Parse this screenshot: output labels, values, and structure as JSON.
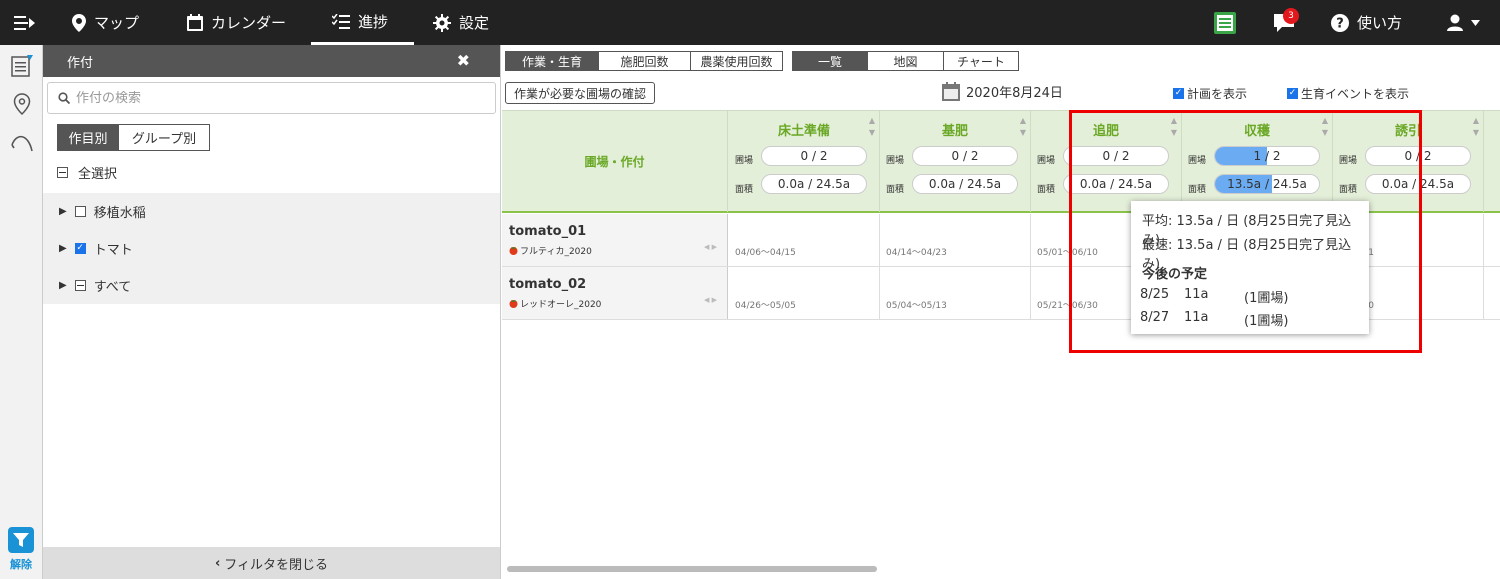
{
  "nav": {
    "items": [
      {
        "label": "マップ"
      },
      {
        "label": "カレンダー"
      },
      {
        "label": "進捗"
      },
      {
        "label": "設定"
      }
    ],
    "notification_count": "3",
    "help_label": "使い方"
  },
  "rail": {
    "release_label": "解除"
  },
  "panel": {
    "title": "作付",
    "search_placeholder": "作付の検索",
    "group_by": [
      "作目別",
      "グループ別"
    ],
    "select_all": "全選択",
    "tree": [
      {
        "label": "移植水稲",
        "state": "unchecked"
      },
      {
        "label": "トマト",
        "state": "checked"
      },
      {
        "label": "すべて",
        "state": "partial"
      }
    ],
    "close_filter": "フィルタを閉じる"
  },
  "main": {
    "mode_tabs": [
      "作業・生育",
      "施肥回数",
      "農薬使用回数"
    ],
    "view_tabs": [
      "一覧",
      "地図",
      "チャート"
    ],
    "check_button": "作業が必要な圃場の確認",
    "date": "2020年8月24日",
    "show_plan": "計画を表示",
    "show_events": "生育イベントを表示",
    "first_col_header": "圃場・作付",
    "field_label": "圃場",
    "area_label": "面積",
    "tasks": [
      {
        "name": "床土準備",
        "fields": "0 / 2",
        "area": "0.0a / 24.5a",
        "fields_fill": 0,
        "area_fill": 0
      },
      {
        "name": "基肥",
        "fields": "0 / 2",
        "area": "0.0a / 24.5a",
        "fields_fill": 0,
        "area_fill": 0
      },
      {
        "name": "追肥",
        "fields": "0 / 2",
        "area": "0.0a / 24.5a",
        "fields_fill": 0,
        "area_fill": 0
      },
      {
        "name": "収穫",
        "fields": "1 / 2",
        "area": "13.5a / 24.5a",
        "fields_fill": 0.5,
        "area_fill": 0.55
      },
      {
        "name": "誘引",
        "fields": "0 / 2",
        "area": "0.0a / 24.5a",
        "fields_fill": 0,
        "area_fill": 0
      }
    ],
    "rows": [
      {
        "name": "tomato_01",
        "crop": "フルティカ_2020",
        "cells": [
          "04/06～04/15",
          "04/14～04/23",
          "05/01～06/10",
          "",
          "～05/31"
        ]
      },
      {
        "name": "tomato_02",
        "crop": "レッドオーレ_2020",
        "cells": [
          "04/26～05/05",
          "05/04～05/13",
          "05/21～06/30",
          "",
          "～06/20"
        ]
      }
    ]
  },
  "tooltip": {
    "avg": "平均: 13.5a / 日 (8月25日完了見込み)",
    "fastest": "最速: 13.5a / 日 (8月25日完了見込み)",
    "plan_title": "今後の予定",
    "plans": [
      {
        "date": "8/25",
        "area": "11a",
        "fields": "(1圃場)"
      },
      {
        "date": "8/27",
        "area": "11a",
        "fields": "(1圃場)"
      }
    ]
  },
  "colors": {
    "accent_green": "#6aa826",
    "header_bg": "#e4efd9",
    "progress_blue": "#6aabf2",
    "highlight_red": "#e00000",
    "badge_red": "#e3181c"
  }
}
